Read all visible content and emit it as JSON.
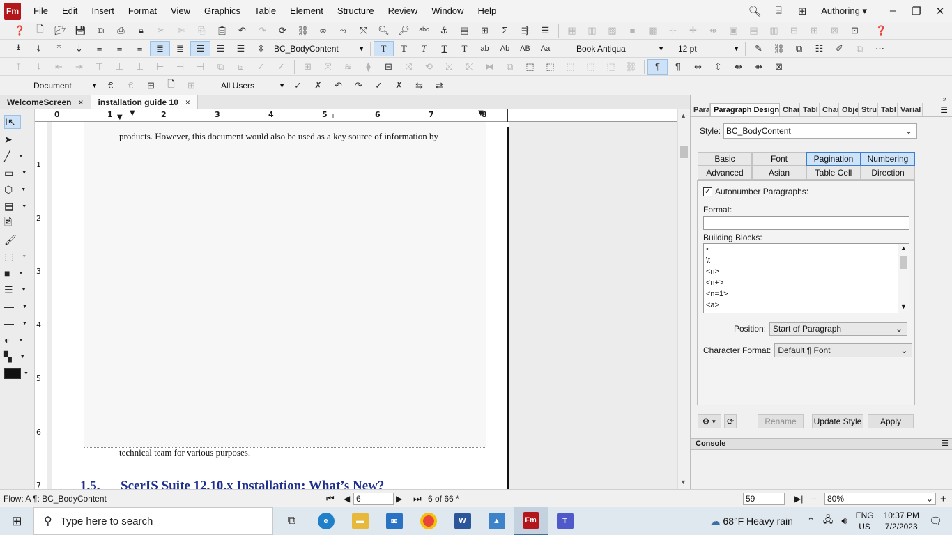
{
  "app": {
    "logo": "Fm",
    "menus": [
      "File",
      "Edit",
      "Insert",
      "Format",
      "View",
      "Graphics",
      "Table",
      "Element",
      "Structure",
      "Review",
      "Window",
      "Help"
    ],
    "workspace": "Authoring"
  },
  "toolbar": {
    "paragraph_style": "BC_BodyContent",
    "font": "Book Antiqua",
    "font_size": "12 pt",
    "view_mode": "Document",
    "audience": "All Users",
    "text_styles": [
      "T",
      "T",
      "T",
      "T",
      "T",
      "ab",
      "Ab",
      "AB",
      "Aa"
    ]
  },
  "tabs": [
    {
      "label": "WelcomeScreen",
      "close": "×"
    },
    {
      "label": "installation guide 10",
      "close": "×"
    }
  ],
  "ruler": {
    "h_numbers": [
      "0",
      "1",
      "2",
      "3",
      "4",
      "5",
      "6",
      "7",
      "8"
    ],
    "v_numbers": [
      "1",
      "2",
      "3",
      "4",
      "5",
      "6",
      "7"
    ]
  },
  "document": {
    "line1": "products. However, this document would also be used as a key source of information by",
    "line2": "technical team for various purposes.",
    "heading_number": "1.5.",
    "heading_text": "ScerIS Suite 12.10.x Installation: What’s New?"
  },
  "panel": {
    "tabs": [
      "Para",
      "Paragraph Designer",
      "Char",
      "Tabl",
      "Char",
      "Obje",
      "Stru",
      "Tabl",
      "Varial"
    ],
    "style_label": "Style:",
    "style_value": "BC_BodyContent",
    "prop_tabs": [
      "Basic",
      "Font",
      "Pagination",
      "Numbering",
      "Advanced",
      "Asian",
      "Table Cell",
      "Direction"
    ],
    "autonumber_label": "Autonumber Paragraphs:",
    "autonumber_checked": "✓",
    "format_label": "Format:",
    "format_value": "",
    "building_blocks_label": "Building Blocks:",
    "building_blocks": [
      "•",
      "\\t",
      "<n>",
      "<n+>",
      "<n=1>",
      "<a>"
    ],
    "position_label": "Position:",
    "position_value": "Start of Paragraph",
    "char_format_label": "Character Format:",
    "char_format_value": "Default ¶ Font",
    "rename": "Rename",
    "update_style": "Update Style",
    "apply": "Apply",
    "console_label": "Console"
  },
  "status": {
    "flow": "Flow: A  ¶: BC_BodyContent",
    "page_input": "6",
    "page_of": "6 of 66 *",
    "number_field": "59",
    "zoom": "80%"
  },
  "taskbar": {
    "search_placeholder": "Type here to search",
    "weather": "68°F  Heavy rain",
    "lang_top": "ENG",
    "lang_bottom": "US",
    "time": "10:37 PM",
    "date": "7/2/2023"
  }
}
